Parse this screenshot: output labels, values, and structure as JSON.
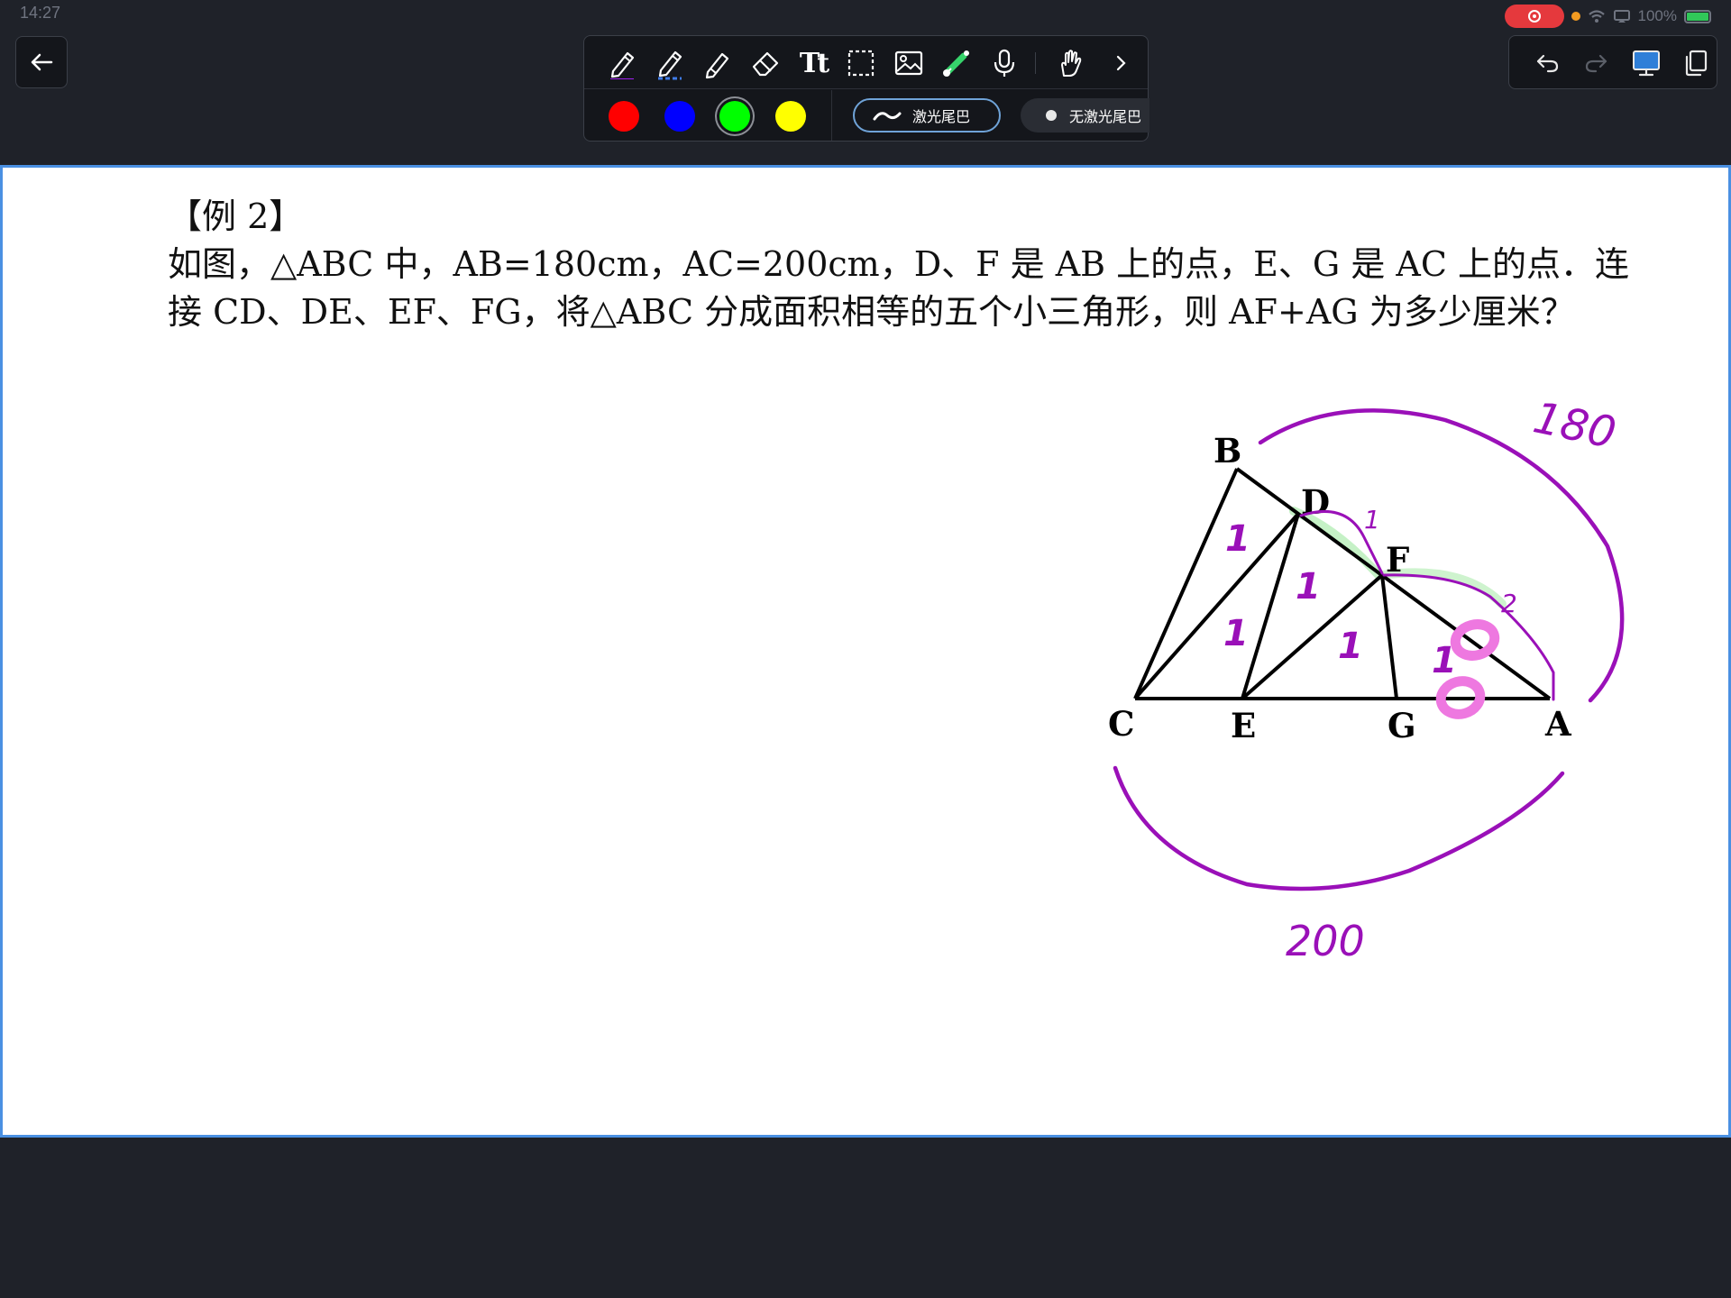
{
  "status_bar": {
    "time": "14:27",
    "battery": "100%"
  },
  "toolbar": {
    "tools": [
      "pen-icon",
      "dotted-pen-icon",
      "pencil-icon",
      "eraser-icon",
      "text-icon",
      "selection-icon",
      "image-icon",
      "laser-pointer-icon",
      "microphone-icon",
      "gesture-icon",
      "chevron-right-icon"
    ],
    "text_tool_label": "Tt",
    "colors": [
      "#ff0000",
      "#0000ff",
      "#00ff00",
      "#ffff00"
    ],
    "selected_color": "#00ff00",
    "laser_tail_label": "激光尾巴",
    "no_laser_tail_label": "无激光尾巴"
  },
  "right_panel": {
    "buttons": [
      "undo-icon",
      "redo-icon",
      "screen-icon",
      "copy-pages-icon"
    ]
  },
  "problem": {
    "heading": "【例 2】",
    "line1": "如图，△ABC 中，AB=180cm，AC=200cm，D、F 是 AB 上的点，E、G 是 AC 上的点．连",
    "line2": "接 CD、DE、EF、FG，将△ABC 分成面积相等的五个小三角形，则 AF+AG 为多少厘米？"
  },
  "figure": {
    "points": {
      "A": "A",
      "B": "B",
      "C": "C",
      "D": "D",
      "E": "E",
      "F": "F",
      "G": "G"
    },
    "annotations": {
      "ab_length": "180",
      "ac_length": "200",
      "df_mark": "1",
      "fa_mark": "2",
      "area_mark": "1",
      "pink_mark": "8"
    }
  }
}
